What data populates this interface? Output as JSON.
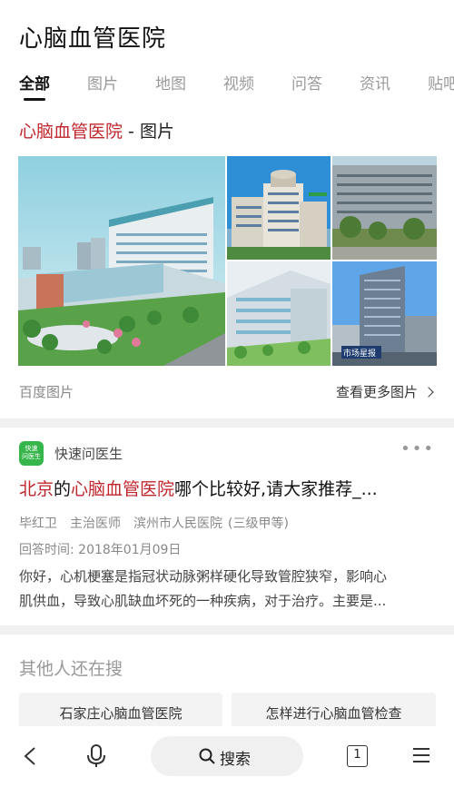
{
  "header": {
    "query": "心脑血管医院",
    "tabs": [
      {
        "label": "全部"
      },
      {
        "label": "图片"
      },
      {
        "label": "地图"
      },
      {
        "label": "视频"
      },
      {
        "label": "问答"
      },
      {
        "label": "资讯"
      },
      {
        "label": "贴吧"
      }
    ]
  },
  "images_card": {
    "title_highlight": "心脑血管医院",
    "title_suffix": " - 图片",
    "source": "百度图片",
    "more_link": "查看更多图片",
    "images": [
      {
        "name": "hospital-aerial",
        "caption": ""
      },
      {
        "name": "hospital-round-tower",
        "caption": ""
      },
      {
        "name": "hospital-campus",
        "caption": ""
      },
      {
        "name": "hospital-render",
        "caption": ""
      },
      {
        "name": "hospital-tall-tower",
        "caption": "市场星报"
      }
    ]
  },
  "qa_card": {
    "source_logo_text_1": "快速",
    "source_logo_text_2": "问医生",
    "source_name": "快速问医生",
    "more": "•••",
    "title_part1": "北京",
    "title_part2": "的",
    "title_part3": "心脑血管医院",
    "title_part4": "哪个比较好,请大家推荐_...",
    "doctor_name": "毕红卫",
    "doctor_title": "主治医师",
    "doctor_hospital": "滨州市人民医院",
    "doctor_level": "(三级甲等)",
    "answer_time": "回答时间: 2018年01月09日",
    "snippet_line1": "你好，心机梗塞是指冠状动脉粥样硬化导致管腔狭窄，影响心",
    "snippet_line2": "肌供血，导致心肌缺血坏死的一种疾病，对于治疗。主要是..."
  },
  "others": {
    "title": "其他人还在搜",
    "chips": [
      "石家庄心脑血管医院",
      "怎样进行心脑血管检查"
    ]
  },
  "bottom_bar": {
    "search_label": "搜索",
    "tab_count": "1"
  },
  "colors": {
    "highlight": "#c0262d",
    "source_logo": "#35b54a",
    "divider": "#f1f1f1"
  }
}
